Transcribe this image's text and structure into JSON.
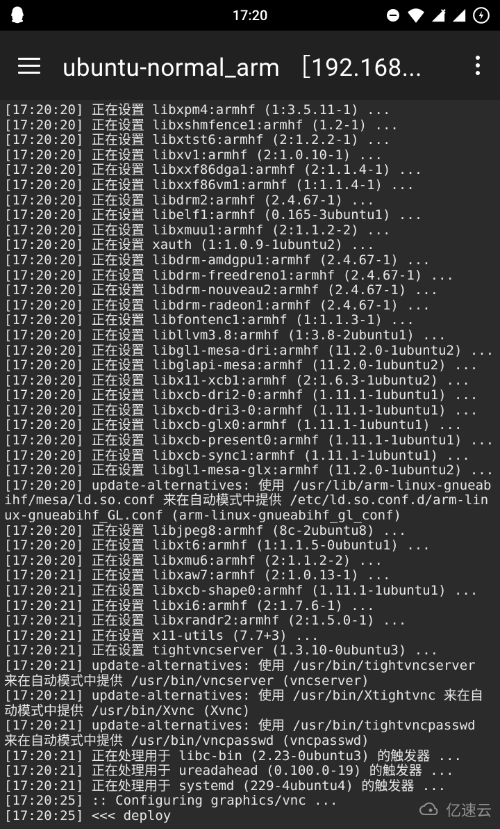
{
  "statusBar": {
    "time": "17:20"
  },
  "appBar": {
    "title": "ubuntu-normal_arm ［192.168..."
  },
  "terminal": {
    "lines": [
      "[17:20:20] 正在设置 libxpm4:armhf (1:3.5.11-1) ...",
      "[17:20:20] 正在设置 libxshmfence1:armhf (1.2-1) ...",
      "[17:20:20] 正在设置 libxtst6:armhf (2:1.2.2-1) ...",
      "[17:20:20] 正在设置 libxv1:armhf (2:1.0.10-1) ...",
      "[17:20:20] 正在设置 libxxf86dga1:armhf (2:1.1.4-1) ...",
      "[17:20:20] 正在设置 libxxf86vm1:armhf (1:1.1.4-1) ...",
      "[17:20:20] 正在设置 libdrm2:armhf (2.4.67-1) ...",
      "[17:20:20] 正在设置 libelf1:armhf (0.165-3ubuntu1) ...",
      "[17:20:20] 正在设置 libxmuu1:armhf (2:1.1.2-2) ...",
      "[17:20:20] 正在设置 xauth (1:1.0.9-1ubuntu2) ...",
      "[17:20:20] 正在设置 libdrm-amdgpu1:armhf (2.4.67-1) ...",
      "[17:20:20] 正在设置 libdrm-freedreno1:armhf (2.4.67-1) ...",
      "[17:20:20] 正在设置 libdrm-nouveau2:armhf (2.4.67-1) ...",
      "[17:20:20] 正在设置 libdrm-radeon1:armhf (2.4.67-1) ...",
      "[17:20:20] 正在设置 libfontenc1:armhf (1:1.1.3-1) ...",
      "[17:20:20] 正在设置 libllvm3.8:armhf (1:3.8-2ubuntu1) ...",
      "[17:20:20] 正在设置 libgl1-mesa-dri:armhf (11.2.0-1ubuntu2) ...",
      "[17:20:20] 正在设置 libglapi-mesa:armhf (11.2.0-1ubuntu2) ...",
      "[17:20:20] 正在设置 libx11-xcb1:armhf (2:1.6.3-1ubuntu2) ...",
      "[17:20:20] 正在设置 libxcb-dri2-0:armhf (1.11.1-1ubuntu1) ...",
      "[17:20:20] 正在设置 libxcb-dri3-0:armhf (1.11.1-1ubuntu1) ...",
      "[17:20:20] 正在设置 libxcb-glx0:armhf (1.11.1-1ubuntu1) ...",
      "[17:20:20] 正在设置 libxcb-present0:armhf (1.11.1-1ubuntu1) ...",
      "[17:20:20] 正在设置 libxcb-sync1:armhf (1.11.1-1ubuntu1) ...",
      "[17:20:20] 正在设置 libgl1-mesa-glx:armhf (11.2.0-1ubuntu2) ...",
      "[17:20:20] update-alternatives: 使用 /usr/lib/arm-linux-gnueabihf/mesa/ld.so.conf 来在自动模式中提供 /etc/ld.so.conf.d/arm-linux-gnueabihf_GL.conf (arm-linux-gnueabihf_gl_conf)",
      "[17:20:20] 正在设置 libjpeg8:armhf (8c-2ubuntu8) ...",
      "[17:20:20] 正在设置 libxt6:armhf (1:1.1.5-0ubuntu1) ...",
      "[17:20:20] 正在设置 libxmu6:armhf (2:1.1.2-2) ...",
      "[17:20:21] 正在设置 libxaw7:armhf (2:1.0.13-1) ...",
      "[17:20:21] 正在设置 libxcb-shape0:armhf (1.11.1-1ubuntu1) ...",
      "[17:20:21] 正在设置 libxi6:armhf (2:1.7.6-1) ...",
      "[17:20:21] 正在设置 libxrandr2:armhf (2:1.5.0-1) ...",
      "[17:20:21] 正在设置 x11-utils (7.7+3) ...",
      "[17:20:21] 正在设置 tightvncserver (1.3.10-0ubuntu3) ...",
      "[17:20:21] update-alternatives: 使用 /usr/bin/tightvncserver 来在自动模式中提供 /usr/bin/vncserver (vncserver)",
      "[17:20:21] update-alternatives: 使用 /usr/bin/Xtightvnc 来在自动模式中提供 /usr/bin/Xvnc (Xvnc)",
      "[17:20:21] update-alternatives: 使用 /usr/bin/tightvncpasswd 来在自动模式中提供 /usr/bin/vncpasswd (vncpasswd)",
      "[17:20:21] 正在处理用于 libc-bin (2.23-0ubuntu3) 的触发器 ...",
      "[17:20:21] 正在处理用于 ureadahead (0.100.0-19) 的触发器 ...",
      "[17:20:21] 正在处理用于 systemd (229-4ubuntu4) 的触发器 ...",
      "[17:20:25] :: Configuring graphics/vnc ...",
      "[17:20:25] <<< deploy"
    ]
  },
  "watermark": {
    "text": "亿速云"
  }
}
